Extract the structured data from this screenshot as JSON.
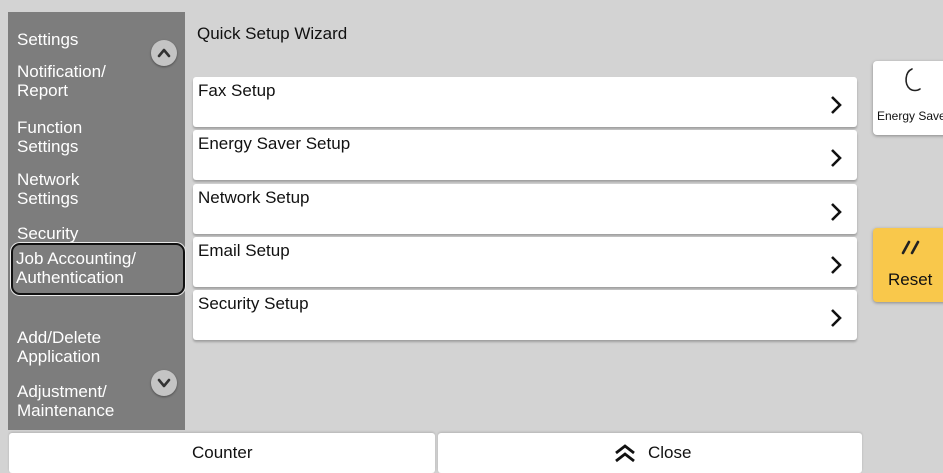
{
  "sidebar": {
    "items": [
      {
        "label": "Settings"
      },
      {
        "label": "Notification/\nReport"
      },
      {
        "label": "Function\nSettings"
      },
      {
        "label": "Network\nSettings"
      },
      {
        "label": "Security\nSettings"
      },
      {
        "label": "Job Accounting/\nAuthentication"
      },
      {
        "label": "Add/Delete\nApplication"
      },
      {
        "label": "Adjustment/\nMaintenance"
      }
    ],
    "scroll_up_icon": "chevron-up-icon",
    "scroll_down_icon": "chevron-down-icon"
  },
  "header": {
    "title": "Quick Setup Wizard"
  },
  "menu": {
    "items": [
      {
        "label": "Fax Setup"
      },
      {
        "label": "Energy Saver Setup"
      },
      {
        "label": "Network Setup"
      },
      {
        "label": "Email Setup"
      },
      {
        "label": "Security Setup"
      }
    ]
  },
  "right_panel": {
    "energy_saver_label": "Energy Saver",
    "energy_saver_icon": "moon-icon",
    "reset_label": "Reset",
    "reset_icon": "reset-slash-icon",
    "reset_color": "#f9c84b"
  },
  "bottom_bar": {
    "counter_label": "Counter",
    "close_label": "Close",
    "close_icon": "double-chevron-up-icon"
  },
  "colors": {
    "background": "#d3d3d3",
    "sidebar": "#7d7d7d",
    "panel": "#ffffff"
  }
}
